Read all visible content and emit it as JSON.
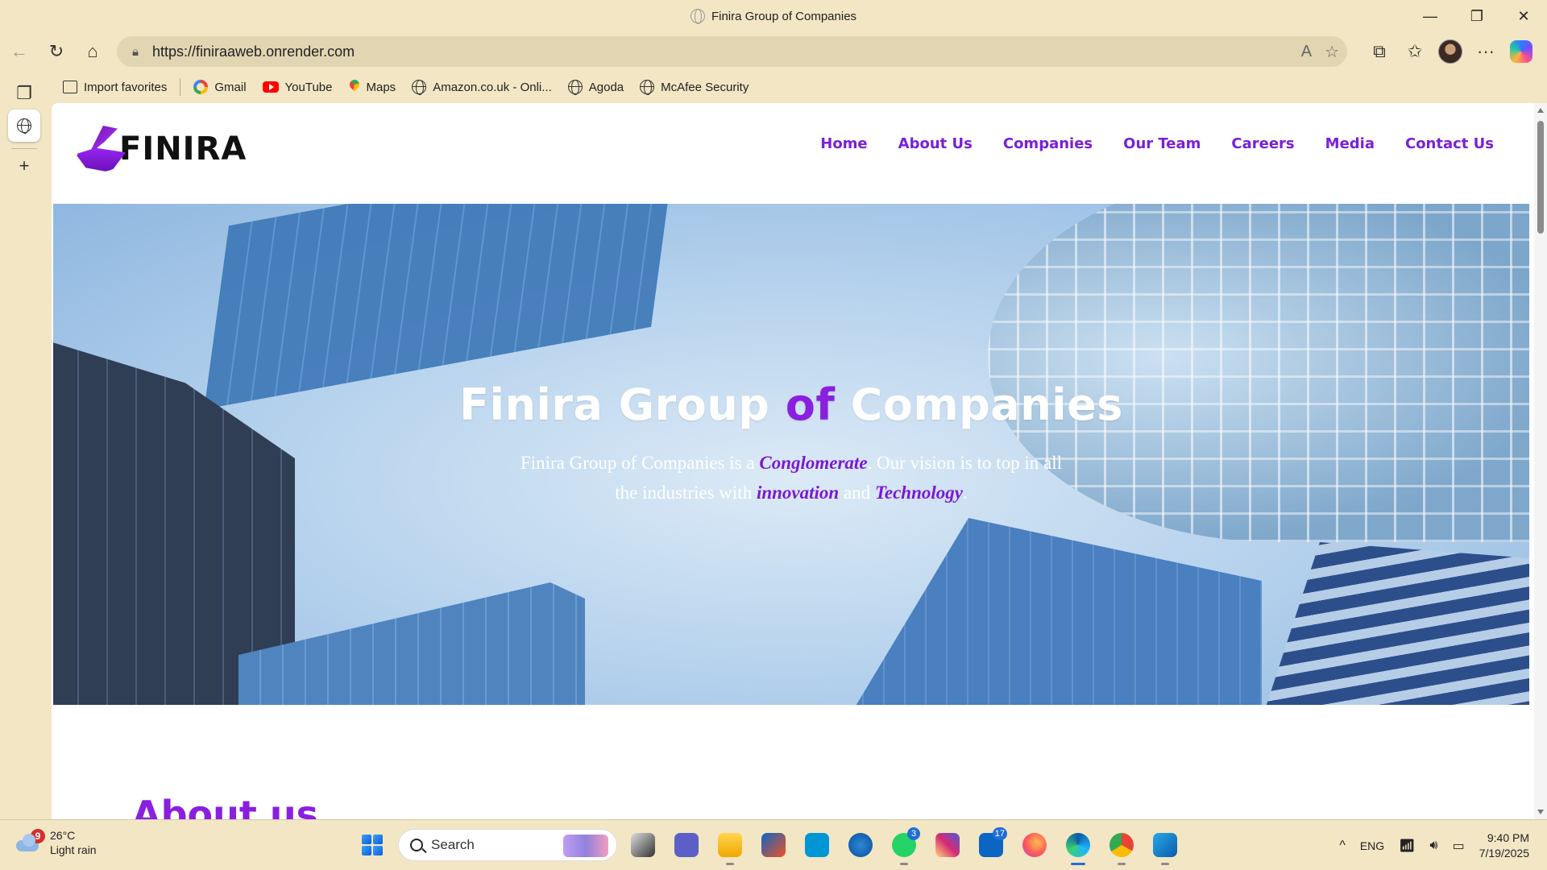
{
  "window": {
    "title": "Finira Group of Companies",
    "controls": {
      "minimize": "—",
      "restore": "❐",
      "close": "✕"
    }
  },
  "toolbar": {
    "url": "https://finiraaweb.onrender.com",
    "read_aloud": "A",
    "more": "···"
  },
  "favorites": [
    {
      "label": "Import favorites",
      "icon": "import-icon"
    },
    {
      "label": "Gmail",
      "icon": "google-icon"
    },
    {
      "label": "YouTube",
      "icon": "youtube-icon"
    },
    {
      "label": "Maps",
      "icon": "maps-pin-icon"
    },
    {
      "label": "Amazon.co.uk - Onli...",
      "icon": "globe-icon"
    },
    {
      "label": "Agoda",
      "icon": "globe-icon"
    },
    {
      "label": "McAfee Security",
      "icon": "globe-icon"
    }
  ],
  "site": {
    "logo_text": "FINIRA",
    "nav": [
      "Home",
      "About Us",
      "Companies",
      "Our Team",
      "Careers",
      "Media",
      "Contact Us"
    ],
    "hero": {
      "title_part1": "Finira Group ",
      "title_accent": "of",
      "title_part2": " Companies",
      "sub_1": "Finira Group of Companies is a ",
      "sub_em1": "Conglomerate",
      "sub_2": ". Our vision is to top in all the industries with ",
      "sub_em2": "innovation",
      "sub_3": " and ",
      "sub_em3": "Technology",
      "sub_4": "."
    },
    "about_heading": "About us"
  },
  "taskbar": {
    "weather": {
      "badge": "9",
      "temp": "26°C",
      "desc": "Light rain"
    },
    "search_label": "Search",
    "apps": [
      {
        "name": "task-view",
        "count": ""
      },
      {
        "name": "teams",
        "count": ""
      },
      {
        "name": "file-explorer",
        "count": ""
      },
      {
        "name": "microsoft-store",
        "count": ""
      },
      {
        "name": "myhp",
        "count": ""
      },
      {
        "name": "get-help",
        "count": ""
      },
      {
        "name": "whatsapp",
        "count": "3"
      },
      {
        "name": "instagram",
        "count": ""
      },
      {
        "name": "linkedin",
        "count": "17"
      },
      {
        "name": "firefox",
        "count": ""
      },
      {
        "name": "edge",
        "count": ""
      },
      {
        "name": "chrome",
        "count": ""
      },
      {
        "name": "outlook",
        "count": ""
      }
    ],
    "tray": {
      "chevron": "^",
      "lang": "ENG",
      "time": "9:40 PM",
      "date": "7/19/2025"
    }
  },
  "colors": {
    "accent_purple": "#7a1fd6",
    "browser_chrome": "#f3e6c4"
  }
}
